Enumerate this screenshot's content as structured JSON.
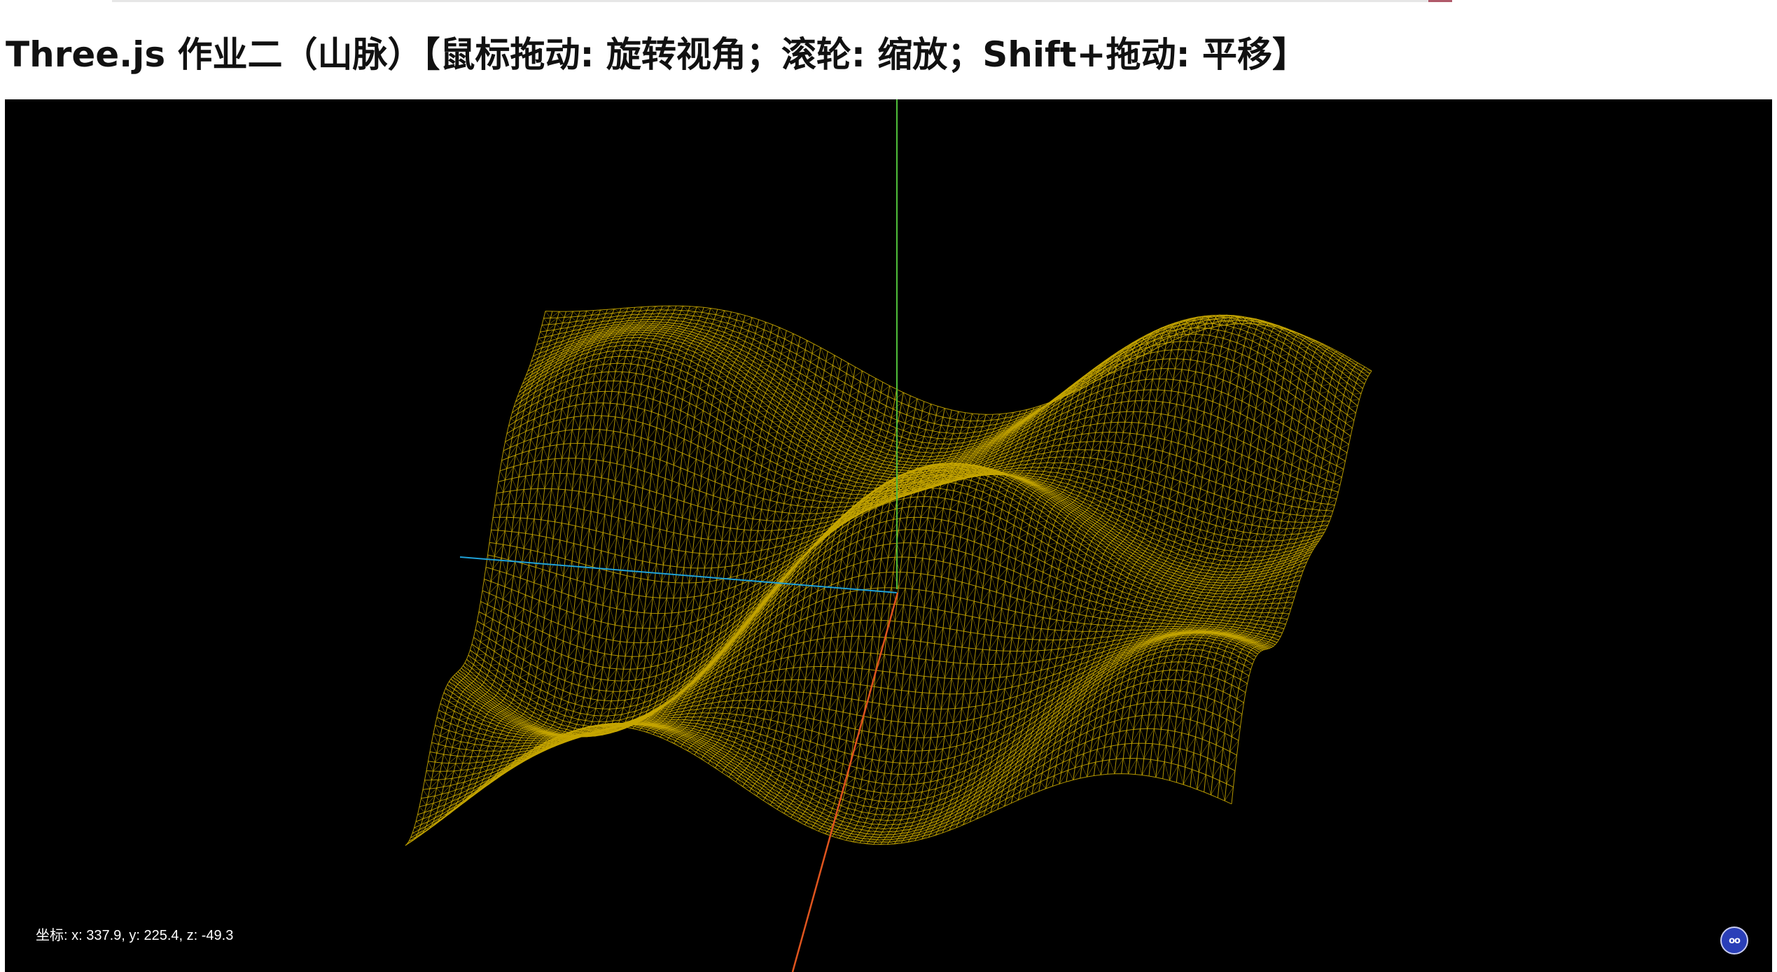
{
  "header": {
    "title": "Three.js 作业二（山脉）【鼠标拖动: 旋转视角；滚轮: 缩放；Shift+拖动: 平移】"
  },
  "viewport": {
    "background": "#000000",
    "mesh_color": "#c7a600",
    "axes": {
      "x_color": "#e0551e",
      "y_color": "#4fbf3a",
      "z_color": "#1fa2d8"
    },
    "status": {
      "coordinates": "坐标: x: 337.9, y: 225.4, z: -49.3"
    },
    "corner_button_icon": "stats-face-icon",
    "corner_button_glyph": "oo"
  }
}
